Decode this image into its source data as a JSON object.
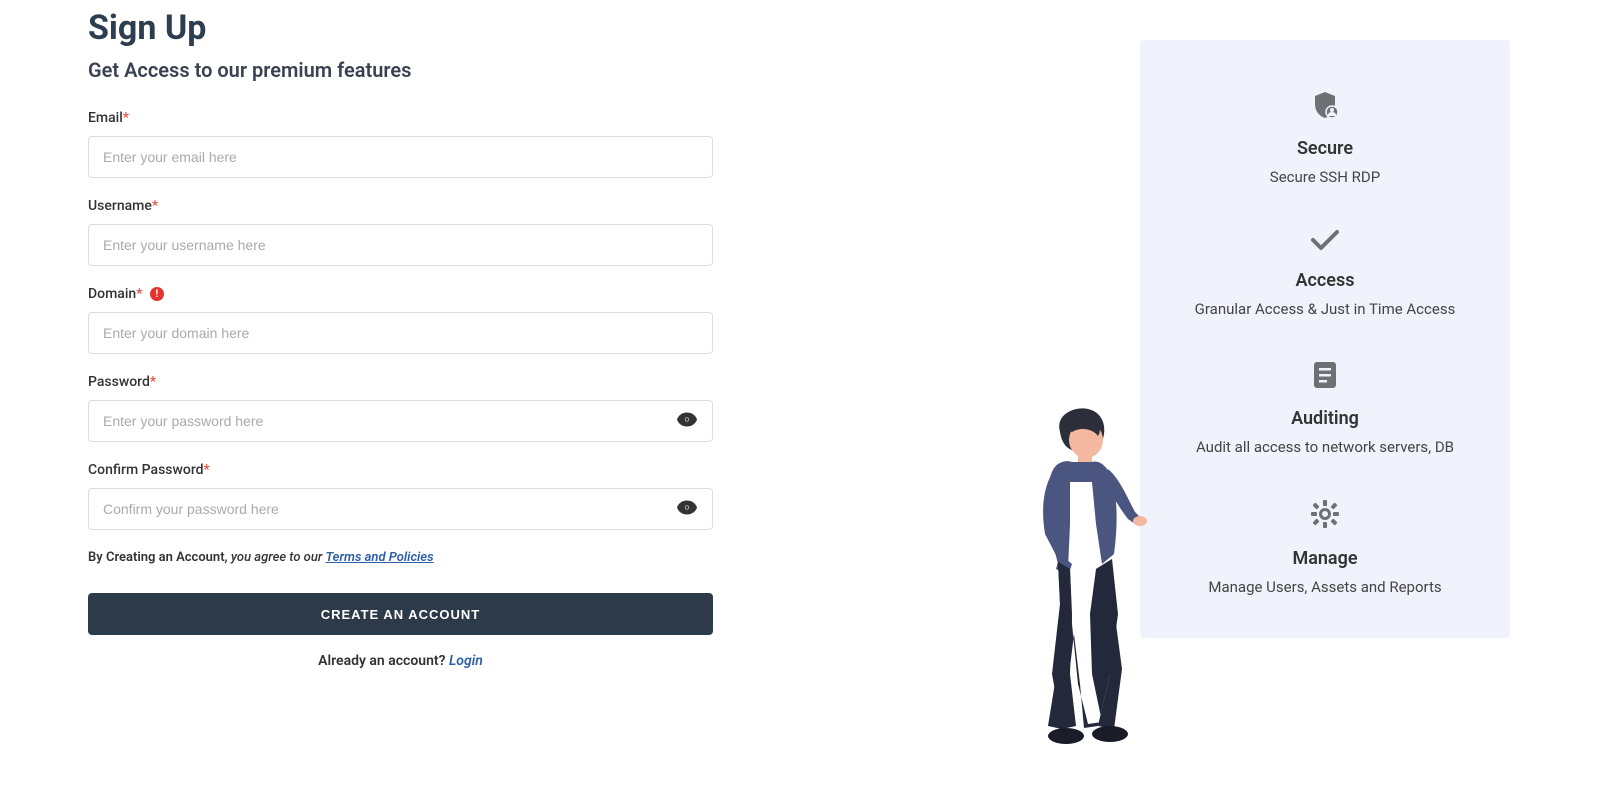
{
  "header": {
    "title": "Sign Up",
    "subtitle": "Get Access to our premium features"
  },
  "form": {
    "email": {
      "label": "Email",
      "placeholder": "Enter your email here"
    },
    "username": {
      "label": "Username",
      "placeholder": "Enter your username here"
    },
    "domain": {
      "label": "Domain",
      "placeholder": "Enter your domain here"
    },
    "password": {
      "label": "Password",
      "placeholder": "Enter your password here"
    },
    "confirmPassword": {
      "label": "Confirm Password",
      "placeholder": "Confirm your password here"
    },
    "agreement": {
      "prefix": "By Creating an Account, ",
      "middle": "you agree to our ",
      "linkText": "Terms and Policies"
    },
    "submitLabel": "CREATE AN ACCOUNT",
    "loginPrompt": "Already an account? ",
    "loginLink": "Login"
  },
  "features": [
    {
      "title": "Secure",
      "description": "Secure SSH RDP"
    },
    {
      "title": "Access",
      "description": "Granular Access & Just in Time Access"
    },
    {
      "title": "Auditing",
      "description": "Audit all access to network servers, DB"
    },
    {
      "title": "Manage",
      "description": "Manage Users, Assets and Reports"
    }
  ]
}
